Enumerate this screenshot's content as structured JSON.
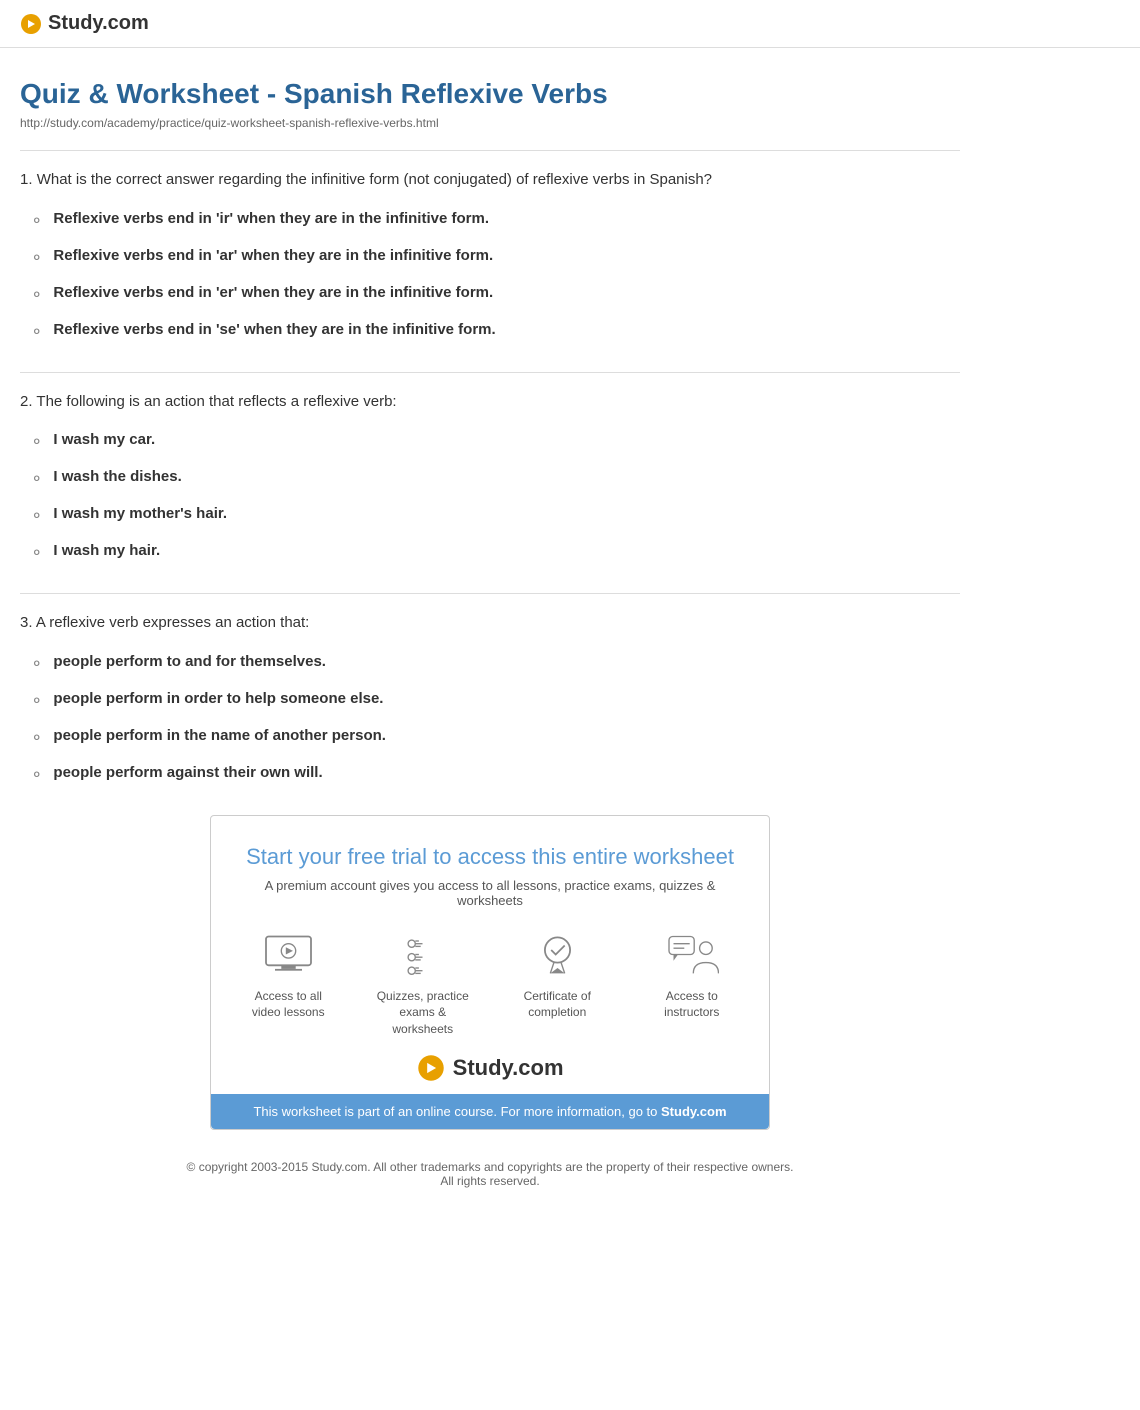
{
  "header": {
    "logo_text": "Study.com",
    "logo_url": "http://study.com"
  },
  "page": {
    "title": "Quiz & Worksheet - Spanish Reflexive Verbs",
    "url": "http://study.com/academy/practice/quiz-worksheet-spanish-reflexive-verbs.html"
  },
  "questions": [
    {
      "number": "1",
      "text": "What is the correct answer regarding the infinitive form (not conjugated) of reflexive verbs in Spanish?",
      "answers": [
        "Reflexive verbs end in 'ir' when they are in the infinitive form.",
        "Reflexive verbs end in 'ar' when they are in the infinitive form.",
        "Reflexive verbs end in 'er' when they are in the infinitive form.",
        "Reflexive verbs end in 'se' when they are in the infinitive form."
      ]
    },
    {
      "number": "2",
      "text": "The following is an action that reflects a reflexive verb:",
      "answers": [
        "I wash my car.",
        "I wash the dishes.",
        "I wash my mother's hair.",
        "I wash my hair."
      ]
    },
    {
      "number": "3",
      "text": "A reflexive verb expresses an action that:",
      "answers": [
        "people perform to and for themselves.",
        "people perform in order to help someone else.",
        "people perform in the name of another person.",
        "people perform against their own will."
      ]
    }
  ],
  "cta": {
    "title": "Start your free trial to access this entire worksheet",
    "subtitle": "A premium account gives you access to all lessons, practice exams, quizzes & worksheets",
    "features": [
      {
        "id": "video",
        "label": "Access to all\nvideo lessons"
      },
      {
        "id": "quizzes",
        "label": "Quizzes, practice\nexams & worksheets"
      },
      {
        "id": "certificate",
        "label": "Certificate of\ncompletion"
      },
      {
        "id": "instructors",
        "label": "Access to\ninstructors"
      }
    ],
    "logo_text": "Study.com",
    "banner_text": "This worksheet is part of an online course. For more information, go to ",
    "banner_link": "Study.com"
  },
  "footer": {
    "copyright": "© copyright 2003-2015 Study.com. All other trademarks and copyrights are the property of their respective owners.",
    "rights": "All rights reserved."
  }
}
